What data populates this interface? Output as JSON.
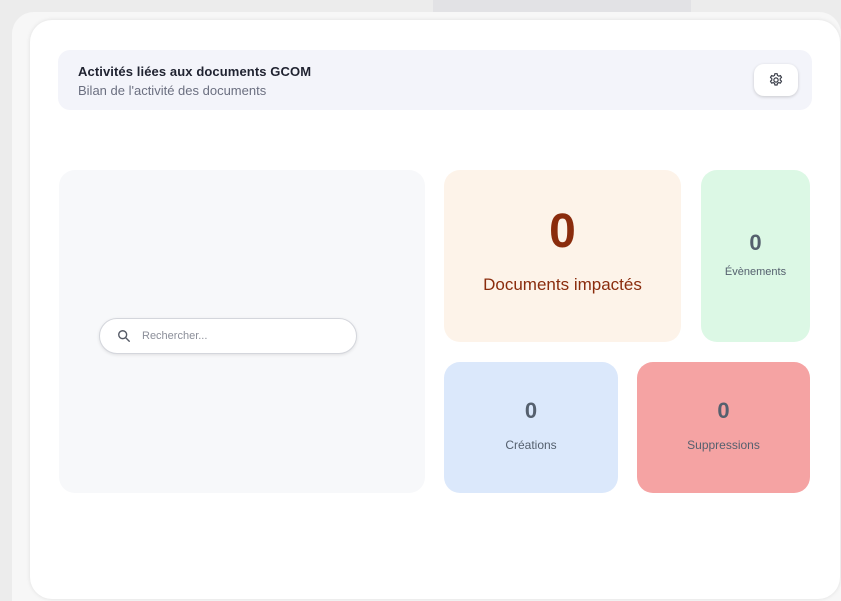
{
  "header": {
    "title": "Activités liées aux documents GCOM",
    "subtitle": "Bilan de l'activité des documents",
    "settings_icon": "gear-icon"
  },
  "search": {
    "placeholder": "Rechercher...",
    "value": "",
    "icon": "search-icon"
  },
  "stats": {
    "documents": {
      "value": "0",
      "label": "Documents impactés",
      "color": "#fdf3e9",
      "text_color": "#8a2c0d"
    },
    "events": {
      "value": "0",
      "label": "Évènements",
      "color": "#dcf8e5"
    },
    "creations": {
      "value": "0",
      "label": "Créations",
      "color": "#dbe8fb"
    },
    "deletions": {
      "value": "0",
      "label": "Suppressions",
      "color": "#f5a3a3"
    }
  }
}
